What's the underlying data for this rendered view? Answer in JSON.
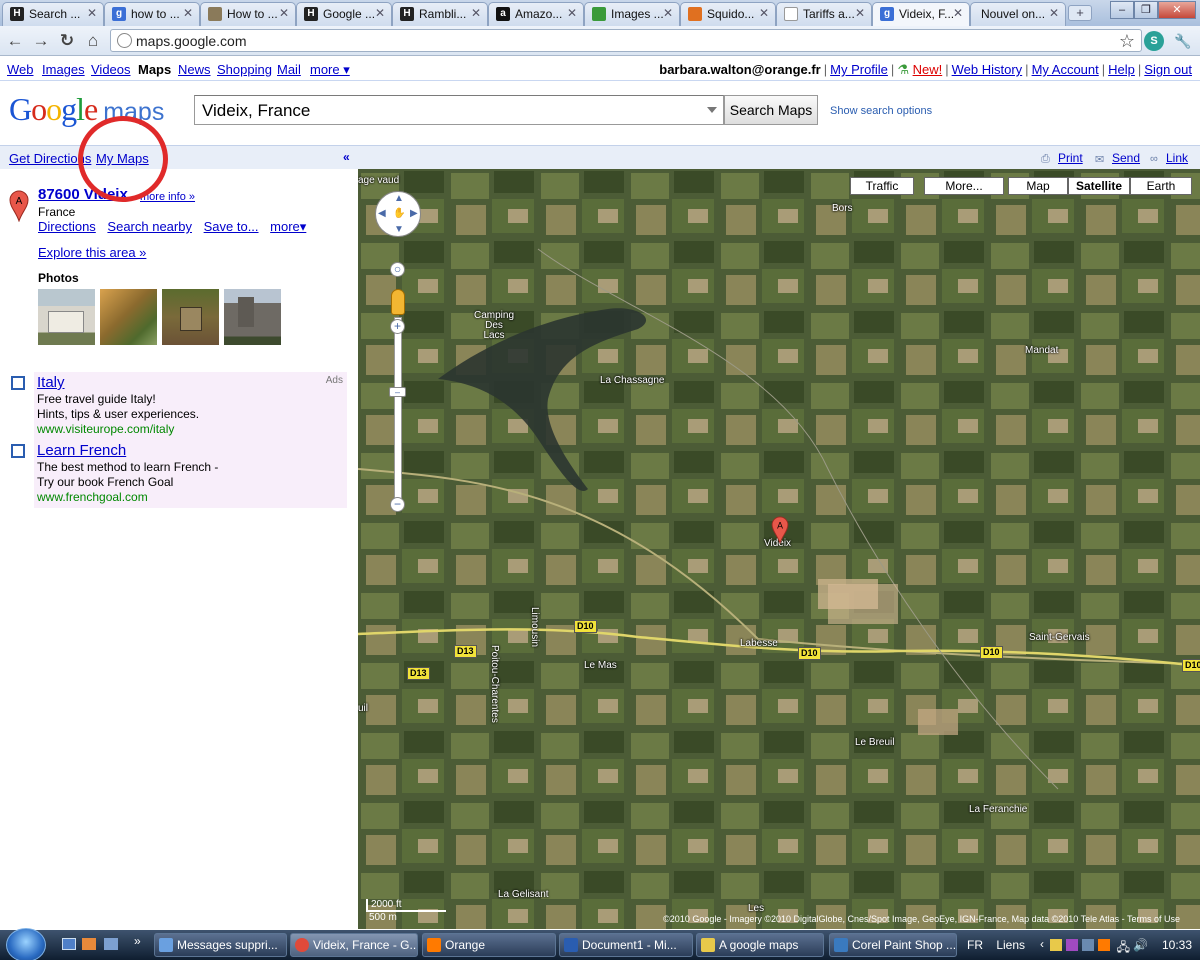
{
  "browser": {
    "tabs": [
      {
        "label": "Search ...",
        "icon": "hub-icon",
        "active": false
      },
      {
        "label": "how to ...",
        "icon": "google-icon",
        "active": false
      },
      {
        "label": "How to ...",
        "icon": "page-icon",
        "active": false
      },
      {
        "label": "Google ...",
        "icon": "hub-icon",
        "active": false
      },
      {
        "label": "Rambli...",
        "icon": "hub-icon",
        "active": false
      },
      {
        "label": "Amazo...",
        "icon": "amazon-icon",
        "active": false
      },
      {
        "label": "Images ...",
        "icon": "shirt-icon",
        "active": false
      },
      {
        "label": "Squido...",
        "icon": "squidoo-icon",
        "active": false
      },
      {
        "label": "Tariffs a...",
        "icon": "doc-icon",
        "active": false
      },
      {
        "label": "Videix, F...",
        "icon": "google-maps-icon",
        "active": true
      },
      {
        "label": "Nouvel on...",
        "icon": "",
        "active": false
      }
    ],
    "url": "maps.google.com"
  },
  "gbar": {
    "links": [
      "Web",
      "Images",
      "Videos",
      "Maps",
      "News",
      "Shopping",
      "Mail",
      "more ▾"
    ],
    "active": "Maps",
    "user": "barbara.walton@orange.fr",
    "right_links": [
      "My Profile",
      "New!",
      "Web History",
      "My Account",
      "Help",
      "Sign out"
    ]
  },
  "header": {
    "logo": "Google",
    "logo_suffix": "maps",
    "search_value": "Videix, France",
    "search_button": "Search Maps",
    "show_options": "Show search options"
  },
  "panel": {
    "get_directions": "Get Directions",
    "my_maps": "My Maps",
    "collapse": "«",
    "result": {
      "marker_letter": "A",
      "title": "87600 Videix",
      "more_info": "more info »",
      "country": "France",
      "actions": [
        "Directions",
        "Search nearby",
        "Save to...",
        "more▾"
      ],
      "explore": "Explore this area »",
      "photos_label": "Photos"
    },
    "ads": {
      "label": "Ads",
      "items": [
        {
          "title": "Italy",
          "lines": [
            "Free travel guide Italy!",
            "Hints, tips & user experiences."
          ],
          "url": "www.visiteurope.com/italy"
        },
        {
          "title": "Learn French",
          "lines": [
            "The best method to learn French -",
            "Try our book French Goal"
          ],
          "url": "www.frenchgoal.com"
        }
      ]
    }
  },
  "map": {
    "links": [
      "Print",
      "Send",
      "Link"
    ],
    "buttons": [
      "Traffic",
      "More...",
      "Map",
      "Satellite",
      "Earth"
    ],
    "active_button": "Satellite",
    "labels": [
      "Bors",
      "Camping Des Lacs",
      "La Chassagne",
      "Mandat",
      "Videix",
      "Labesse",
      "Saint-Gervais",
      "Le Mas",
      "Le Breuil",
      "La Feranchie",
      "La Gelisant",
      "Les",
      "Poitou-Charentes",
      "Limousin",
      "age vaud",
      "uil"
    ],
    "roads": [
      "D10",
      "D10",
      "D10",
      "D10",
      "D13",
      "D13"
    ],
    "scale_ft": "2000 ft",
    "scale_m": "500 m",
    "copyright": "©2010 Google - Imagery ©2010 DigitalGlobe, Cnes/Spot Image, GeoEye, IGN-France, Map data ©2010 Tele Atlas - Terms of Use",
    "marker_letter": "A"
  },
  "taskbar": {
    "tasks": [
      {
        "label": "Messages suppri...",
        "active": false
      },
      {
        "label": "Videix, France - G...",
        "active": true
      },
      {
        "label": "Orange",
        "active": false
      },
      {
        "label": "Document1 - Mi...",
        "active": false
      },
      {
        "label": "A google maps",
        "active": false
      },
      {
        "label": "Corel Paint Shop ...",
        "active": false
      }
    ],
    "lang": "FR",
    "links": "Liens",
    "time": "10:33"
  }
}
